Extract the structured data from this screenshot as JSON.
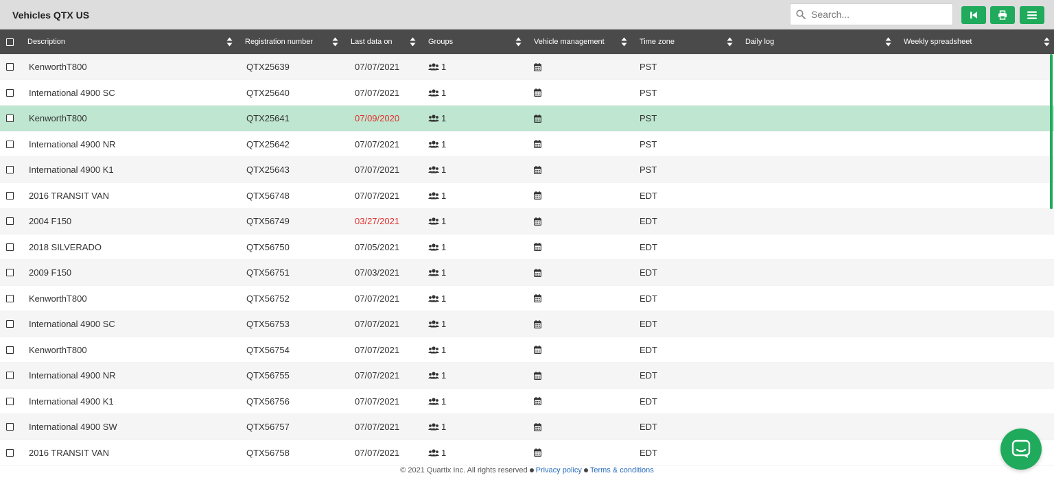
{
  "header": {
    "title": "Vehicles QTX US",
    "search_placeholder": "Search...",
    "buttons": [
      {
        "icon": "skip-back-icon"
      },
      {
        "icon": "print-icon"
      },
      {
        "icon": "menu-icon"
      }
    ]
  },
  "columns": [
    {
      "key": "description",
      "label": "Description"
    },
    {
      "key": "registration",
      "label": "Registration number"
    },
    {
      "key": "last_data",
      "label": "Last data on"
    },
    {
      "key": "groups",
      "label": "Groups"
    },
    {
      "key": "vehicle_management",
      "label": "Vehicle management"
    },
    {
      "key": "time_zone",
      "label": "Time zone"
    },
    {
      "key": "daily_log",
      "label": "Daily log"
    },
    {
      "key": "weekly_spreadsheet",
      "label": "Weekly spreadsheet"
    }
  ],
  "rows": [
    {
      "description": "KenworthT800",
      "registration": "QTX25639",
      "last_data": "07/07/2021",
      "late": false,
      "groups": "1",
      "time_zone": "PST"
    },
    {
      "description": "International 4900 SC",
      "registration": "QTX25640",
      "last_data": "07/07/2021",
      "late": false,
      "groups": "1",
      "time_zone": "PST"
    },
    {
      "description": "KenworthT800",
      "registration": "QTX25641",
      "last_data": "07/09/2020",
      "late": true,
      "selected": true,
      "groups": "1",
      "time_zone": "PST"
    },
    {
      "description": "International 4900 NR",
      "registration": "QTX25642",
      "last_data": "07/07/2021",
      "late": false,
      "groups": "1",
      "time_zone": "PST"
    },
    {
      "description": "International 4900 K1",
      "registration": "QTX25643",
      "last_data": "07/07/2021",
      "late": false,
      "groups": "1",
      "time_zone": "PST"
    },
    {
      "description": "2016 TRANSIT VAN",
      "registration": "QTX56748",
      "last_data": "07/07/2021",
      "late": false,
      "groups": "1",
      "time_zone": "EDT"
    },
    {
      "description": "2004 F150",
      "registration": "QTX56749",
      "last_data": "03/27/2021",
      "late": true,
      "groups": "1",
      "time_zone": "EDT"
    },
    {
      "description": "2018 SILVERADO",
      "registration": "QTX56750",
      "last_data": "07/05/2021",
      "late": false,
      "groups": "1",
      "time_zone": "EDT"
    },
    {
      "description": "2009 F150",
      "registration": "QTX56751",
      "last_data": "07/03/2021",
      "late": false,
      "groups": "1",
      "time_zone": "EDT"
    },
    {
      "description": "KenworthT800",
      "registration": "QTX56752",
      "last_data": "07/07/2021",
      "late": false,
      "groups": "1",
      "time_zone": "EDT"
    },
    {
      "description": "International 4900 SC",
      "registration": "QTX56753",
      "last_data": "07/07/2021",
      "late": false,
      "groups": "1",
      "time_zone": "EDT"
    },
    {
      "description": "KenworthT800",
      "registration": "QTX56754",
      "last_data": "07/07/2021",
      "late": false,
      "groups": "1",
      "time_zone": "EDT"
    },
    {
      "description": "International 4900 NR",
      "registration": "QTX56755",
      "last_data": "07/07/2021",
      "late": false,
      "groups": "1",
      "time_zone": "EDT"
    },
    {
      "description": "International 4900 K1",
      "registration": "QTX56756",
      "last_data": "07/07/2021",
      "late": false,
      "groups": "1",
      "time_zone": "EDT"
    },
    {
      "description": "International 4900 SW",
      "registration": "QTX56757",
      "last_data": "07/07/2021",
      "late": false,
      "groups": "1",
      "time_zone": "EDT"
    },
    {
      "description": "2016 TRANSIT VAN",
      "registration": "QTX56758",
      "last_data": "07/07/2021",
      "late": false,
      "groups": "1",
      "time_zone": "EDT"
    }
  ],
  "footer": {
    "copyright": "© 2021 Quartix Inc. All rights reserved",
    "privacy": "Privacy policy",
    "terms": "Terms & conditions"
  },
  "colors": {
    "accent": "#1faa5c",
    "header_bg": "#4a4a4a",
    "selected_row": "#bfe6d1",
    "late_date": "#e0302c",
    "link": "#2a6ebb"
  }
}
